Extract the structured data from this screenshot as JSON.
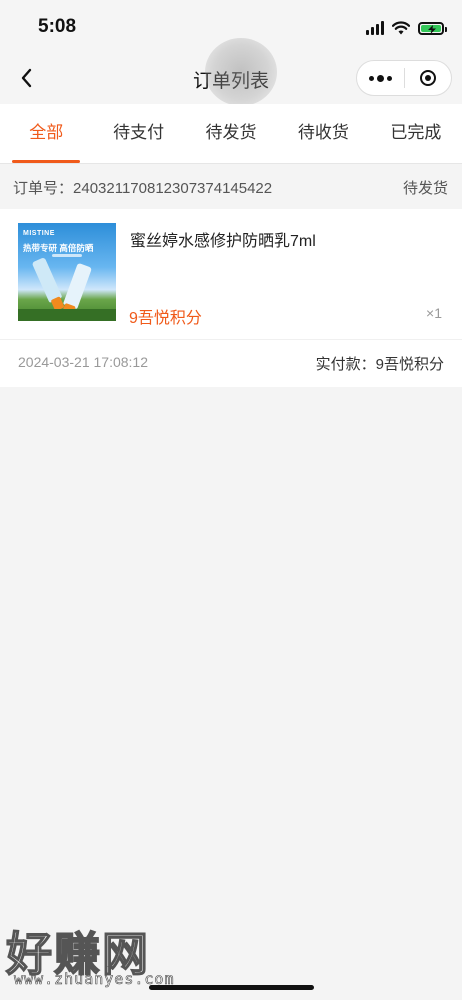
{
  "status": {
    "time": "5:08"
  },
  "header": {
    "title": "订单列表"
  },
  "tabs": [
    {
      "label": "全部"
    },
    {
      "label": "待支付"
    },
    {
      "label": "待发货"
    },
    {
      "label": "待收货"
    },
    {
      "label": "已完成"
    }
  ],
  "order": {
    "number_label": "订单号：",
    "number": "2403211708123073741454 22",
    "status": "待发货",
    "product": {
      "name": "蜜丝婷水感修护防晒乳7ml",
      "price": "9吾悦积分",
      "quantity": "×1",
      "image_brand": "MISTINE",
      "image_slogan": "热带专研 高倍防晒"
    },
    "time": "2024-03-21 17:08:12",
    "paid_label": "实付款：",
    "paid_amount": "9吾悦积分"
  },
  "watermark": {
    "main": "好赚网",
    "url": "www.zhuanyes.com"
  }
}
